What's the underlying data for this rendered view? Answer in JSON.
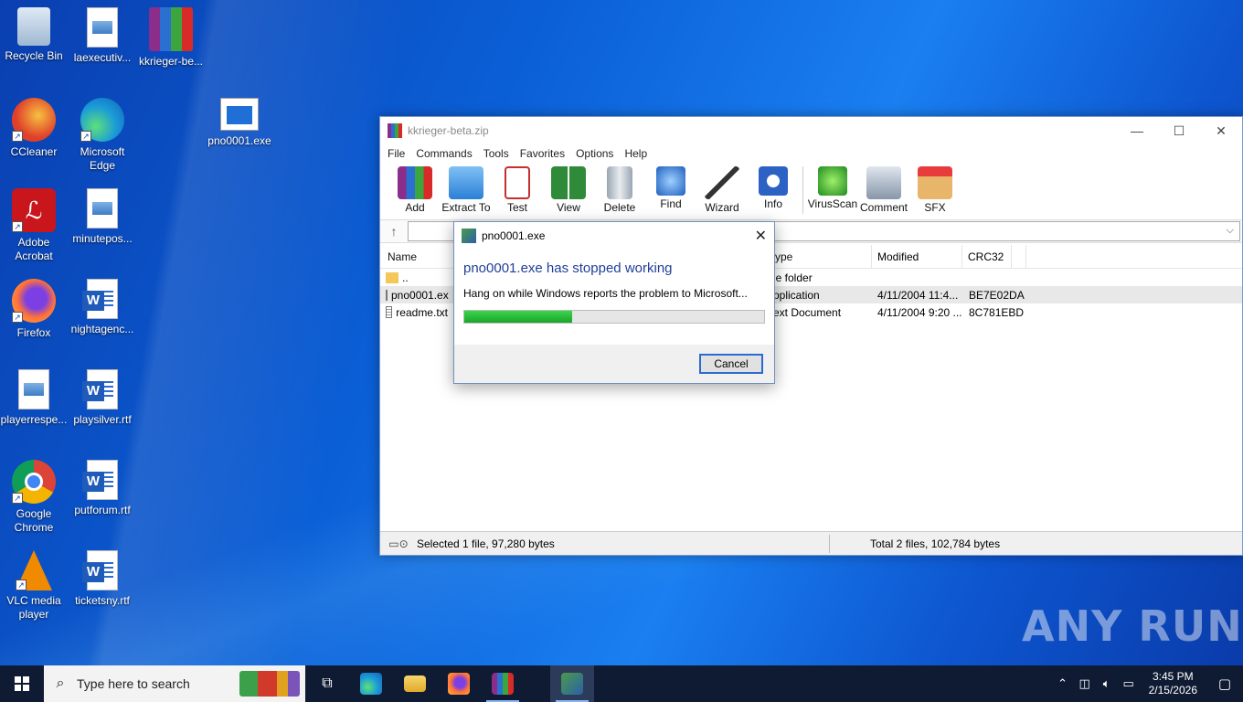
{
  "desktop": {
    "icons": [
      {
        "label": "Recycle Bin"
      },
      {
        "label": "laexecutiv..."
      },
      {
        "label": "kkrieger-be..."
      },
      {
        "label": "CCleaner"
      },
      {
        "label": "Microsoft Edge"
      },
      {
        "label": "pno0001.exe"
      },
      {
        "label": "Adobe Acrobat"
      },
      {
        "label": "minutepos..."
      },
      {
        "label": "Firefox"
      },
      {
        "label": "nightagenc..."
      },
      {
        "label": "playerrespe..."
      },
      {
        "label": "playsilver.rtf"
      },
      {
        "label": "Google Chrome"
      },
      {
        "label": "putforum.rtf"
      },
      {
        "label": "VLC media player"
      },
      {
        "label": "ticketsny.rtf"
      }
    ]
  },
  "winrar": {
    "title": "kkrieger-beta.zip",
    "menu": [
      "File",
      "Commands",
      "Tools",
      "Favorites",
      "Options",
      "Help"
    ],
    "toolbar": [
      "Add",
      "Extract To",
      "Test",
      "View",
      "Delete",
      "Find",
      "Wizard",
      "Info",
      "VirusScan",
      "Comment",
      "SFX"
    ],
    "columns": {
      "name": "Name",
      "type": "ype",
      "modified": "Modified",
      "crc": "CRC32"
    },
    "files": [
      {
        "name": "..",
        "type": "le folder",
        "modified": "",
        "crc": ""
      },
      {
        "name": "pno0001.ex",
        "type": "pplication",
        "modified": "4/11/2004 11:4...",
        "crc": "BE7E02DA"
      },
      {
        "name": "readme.txt",
        "type": "ext Document",
        "modified": "4/11/2004 9:20 ...",
        "crc": "8C781EBD"
      }
    ],
    "status_left": "Selected 1 file, 97,280 bytes",
    "status_right": "Total 2 files, 102,784 bytes"
  },
  "dialog": {
    "title": "pno0001.exe",
    "heading": "pno0001.exe has stopped working",
    "message": "Hang on while Windows reports the problem to Microsoft...",
    "progress": 0.36,
    "cancel_label": "Cancel"
  },
  "taskbar": {
    "search_placeholder": "Type here to search",
    "time": "3:45 PM",
    "date": "2/15/2026"
  },
  "watermark": "ANY RUN"
}
